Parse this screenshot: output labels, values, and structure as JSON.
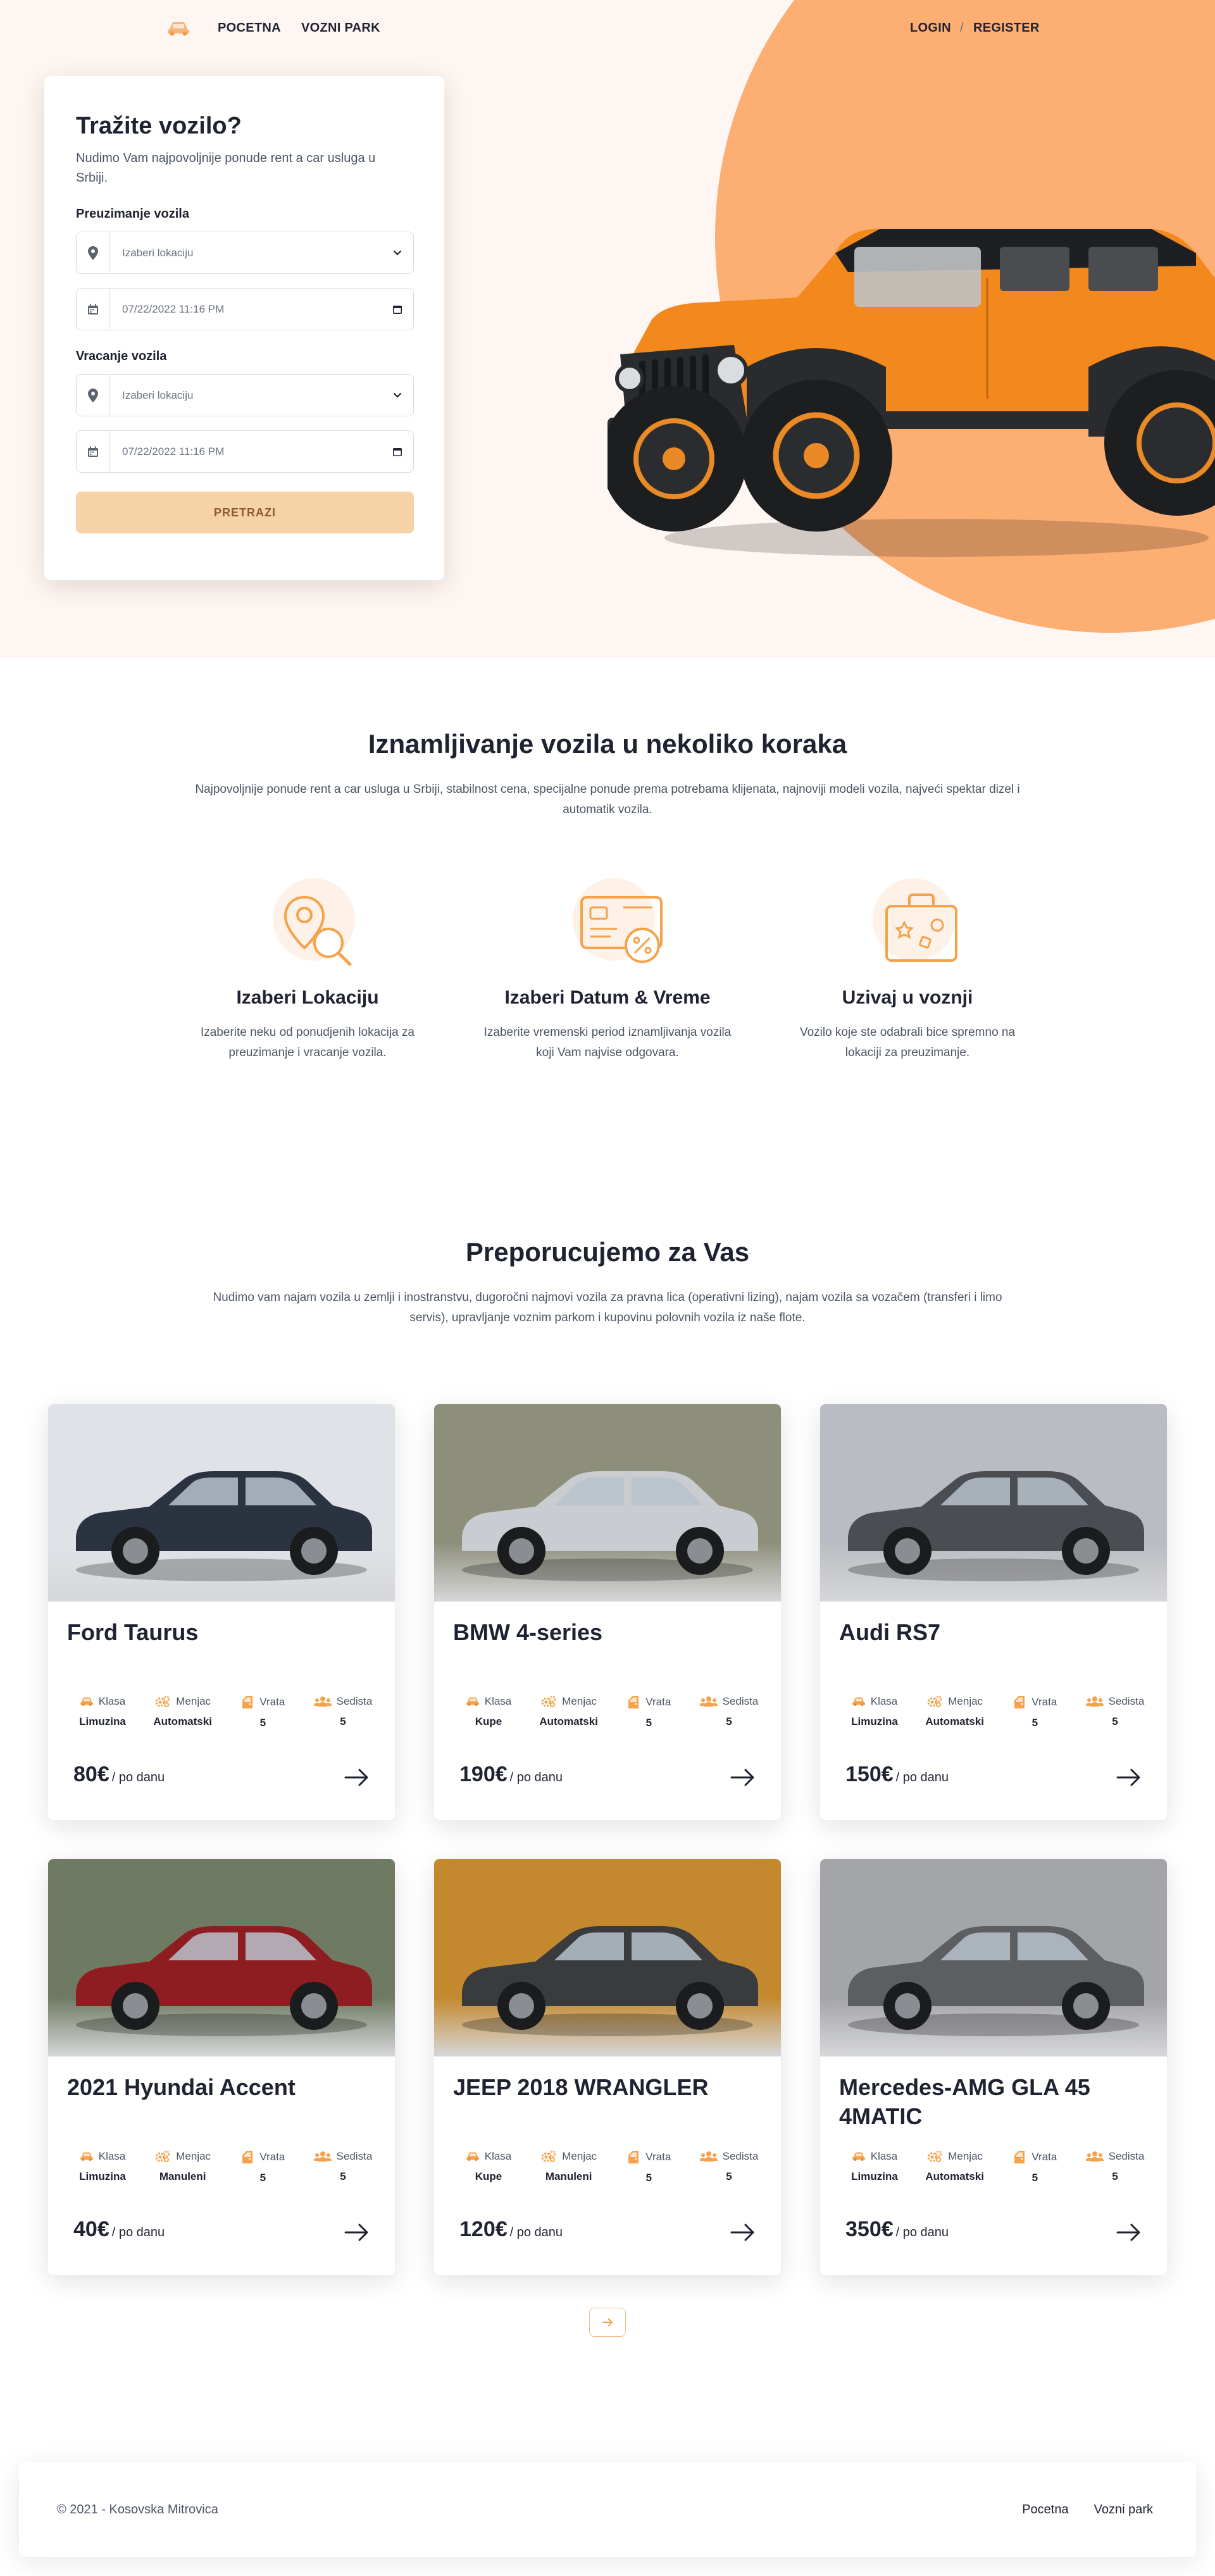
{
  "nav": {
    "logo_icon": "car-icon",
    "links": [
      "POCETNA",
      "VOZNI PARK"
    ],
    "login": "LOGIN",
    "separator": "/",
    "register": "REGISTER"
  },
  "search": {
    "title": "Tražite vozilo?",
    "lead": "Nudimo Vam najpovoljnije ponude rent a car usluga u Srbiji.",
    "pickup_label": "Preuzimanje vozila",
    "pickup_location": "Izaberi lokaciju",
    "pickup_datetime": "07/22/2022 11:16 PM",
    "return_label": "Vracanje vozila",
    "return_location": "Izaberi lokaciju",
    "return_datetime": "07/22/2022 11:16 PM",
    "button": "PRETRAZI"
  },
  "steps": {
    "title": "Iznamljivanje vozila u nekoliko koraka",
    "subtitle": "Najpovoljnije ponude rent a car usluga u Srbiji, stabilnost cena, specijalne ponude prema potrebama klijenata, najnoviji modeli vozila, najveći spektar dizel i automatik vozila.",
    "items": [
      {
        "icon": "location-search-icon",
        "title": "Izaberi Lokaciju",
        "text": "Izaberite neku od ponudjenih lokacija za preuzimanje i vracanje vozila."
      },
      {
        "icon": "card-discount-icon",
        "title": "Izaberi Datum & Vreme",
        "text": "Izaberite vremenski period iznamljivanja vozila koji Vam najvise odgovara."
      },
      {
        "icon": "travel-bag-icon",
        "title": "Uzivaj u voznji",
        "text": "Vozilo koje ste odabrali bice spremno na lokaciji za preuzimanje."
      }
    ]
  },
  "cars": {
    "title": "Preporucujemo za Vas",
    "subtitle": "Nudimo vam najam vozila u zemlji i inostranstvu, dugoročni najmovi vozila za pravna lica (operativni lizing), najam vozila sa vozačem (transferi i limo servis), upravljanje voznim parkom i kupovinu polovnih vozila iz naše flote.",
    "labels": {
      "klasa": "Klasa",
      "menjac": "Menjac",
      "vrata": "Vrata",
      "sedista": "Sedista",
      "per_day": "/ po danu"
    },
    "items": [
      {
        "name": "Ford Taurus",
        "klasa": "Limuzina",
        "menjac": "Automatski",
        "vrata": "5",
        "sedista": "5",
        "price": "80€",
        "bg": "#dfe3e8",
        "body": "#2c3340"
      },
      {
        "name": "BMW 4-series",
        "klasa": "Kupe",
        "menjac": "Automatski",
        "vrata": "5",
        "sedista": "5",
        "price": "190€",
        "bg": "#8e8f7a",
        "body": "#c9ccd0"
      },
      {
        "name": "Audi RS7",
        "klasa": "Limuzina",
        "menjac": "Automatski",
        "vrata": "5",
        "sedista": "5",
        "price": "150€",
        "bg": "#b9bcc2",
        "body": "#4a4d52"
      },
      {
        "name": "2021 Hyundai Accent",
        "klasa": "Limuzina",
        "menjac": "Manuleni",
        "vrata": "5",
        "sedista": "5",
        "price": "40€",
        "bg": "#6f7a62",
        "body": "#8e1d22"
      },
      {
        "name": "JEEP 2018 WRANGLER",
        "klasa": "Kupe",
        "menjac": "Manuleni",
        "vrata": "5",
        "sedista": "5",
        "price": "120€",
        "bg": "#c4892e",
        "body": "#3a3b3d"
      },
      {
        "name": "Mercedes-AMG GLA 45 4MATIC",
        "klasa": "Limuzina",
        "menjac": "Automatski",
        "vrata": "5",
        "sedista": "5",
        "price": "350€",
        "bg": "#a4a5a8",
        "body": "#5c5e61"
      }
    ]
  },
  "footer": {
    "copyright": "© 2021 - Kosovska Mitrovica",
    "links": [
      "Pocetna",
      "Vozni park"
    ]
  },
  "colors": {
    "accent": "#fdae72",
    "accent_light": "#f6d3a6",
    "icon": "#f5a24b",
    "hero_bg": "#fef6f2"
  }
}
